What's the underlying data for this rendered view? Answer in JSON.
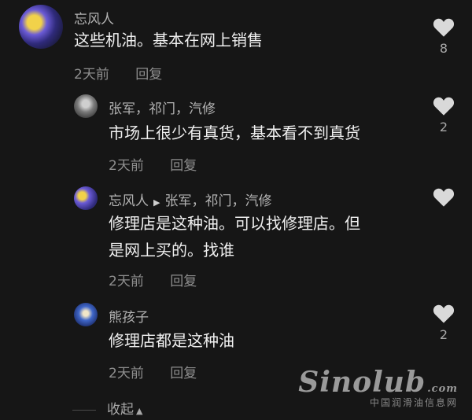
{
  "comments": [
    {
      "user": "忘风人",
      "text_lines": [
        "这些机油。基本在网上销售"
      ],
      "time": "2天前",
      "reply": "回复",
      "likes": "8"
    },
    {
      "user": "张军，祁门，汽修",
      "text_lines": [
        "市场上很少有真货，基本看不到真货"
      ],
      "time": "2天前",
      "reply": "回复",
      "likes": "2"
    },
    {
      "user": "忘风人",
      "reply_to": "张军，祁门，汽修",
      "text_lines": [
        "修理店是这种油。可以找修理店。但",
        "是网上买的。找谁"
      ],
      "time": "2天前",
      "reply": "回复",
      "likes": ""
    },
    {
      "user": "熊孩子",
      "text_lines": [
        "修理店都是这种油"
      ],
      "time": "2天前",
      "reply": "回复",
      "likes": "2"
    }
  ],
  "collapse_label": "收起",
  "watermark": {
    "logo": "Sinolub",
    "domain": ".com",
    "subtitle": "中国润滑油信息网"
  },
  "icons": {
    "like": "heart-icon",
    "reply_arrow": "play-triangle-icon",
    "collapse_arrow": "caret-up-icon"
  },
  "colors": {
    "background": "#161616",
    "heart": "#d9d9d9"
  }
}
